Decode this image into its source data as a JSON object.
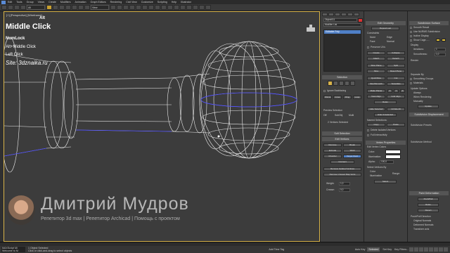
{
  "menu": [
    "Edit",
    "Tools",
    "Group",
    "Views",
    "Create",
    "Modifiers",
    "Animation",
    "Graph Editors",
    "Rendering",
    "Civil View",
    "Customize",
    "Scripting",
    "Help",
    "Illustrator"
  ],
  "toolbar": {
    "selection_filter": "All",
    "view_dropdown": "View"
  },
  "viewport": {
    "label": "[+] [Perspective] [Wireframe]"
  },
  "keys": {
    "alt": "Alt",
    "middle_click": "Middle Click",
    "numlock": "NumLock",
    "alt_middle_click": "Alt+Middle Click",
    "left_click": "Left Click",
    "site": "Site: 3dznaika.ru"
  },
  "author": {
    "name": "Дмитрий Мудров",
    "subtitle": "Репетитор 3d max | Репетитор Archicad | Помощь с проектом"
  },
  "status": {
    "script_box": "MAXScript Mi",
    "welcome": "Welcome to M",
    "object_selected": "1 Object Selected",
    "hint": "Click or click-and-drag to select objects",
    "selected_badge": "Selected",
    "add_time_tag": "Add Time Tag",
    "auto_key": "Auto Key",
    "set_key": "Set Key",
    "key_filters": "Key Filters..."
  },
  "panel_mid": {
    "object_name": "Object011",
    "modifier_list": "Modifier List",
    "stack_item": "Editable Poly",
    "selection_rollout": "Selection",
    "ignore_backfacing": "Ignore Backfacing",
    "grow": "Grow",
    "shrink": "Shrink",
    "ring": "Ring",
    "loop": "Loop",
    "preview_selection": "Preview Selection",
    "preview_opts": [
      "Off",
      "SubObj",
      "Multi"
    ],
    "vertices_selected": "2 Vertices Selected",
    "soft_selection": "Soft Selection",
    "edit_vertices": "Edit Vertices",
    "remove": "Remove",
    "break": "Break",
    "extrude": "Extrude",
    "weld": "Weld",
    "chamfer": "Chamfer",
    "target_weld": "Target Weld",
    "connect": "Connect",
    "remove_isolated": "Remove Isolated Vertices",
    "remove_unused": "Remove Unused Map Verts",
    "weight_label": "Weight:",
    "weight_value": "1,0",
    "crease_label": "Crease:",
    "crease_value": "0,0"
  },
  "panel_right": {
    "edit_geometry": "Edit Geometry",
    "repeat_last": "Repeat Last",
    "constraints": "Constraints",
    "constraint_opts": [
      "None",
      "Edge",
      "Face",
      "Normal"
    ],
    "preserve_uvs": "Preserve UVs",
    "create": "Create",
    "collapse": "Collapse",
    "attach": "Attach",
    "detach": "Detach",
    "slice_plane": "Slice Plane",
    "split": "Split",
    "slice": "Slice",
    "reset_plane": "Reset Plane",
    "quickslice": "QuickSlice",
    "cut": "Cut",
    "meshsmooth": "MeshSmooth",
    "tessellate": "Tessellate",
    "make_planar": "Make Planar",
    "xyz": [
      "X",
      "Y",
      "Z"
    ],
    "view_align": "View Align",
    "grid_align": "Grid Align",
    "relax": "Relax",
    "hide_selected": "Hide Selected",
    "unhide_all": "Unhide All",
    "hide_unselected": "Hide Unselected",
    "named_selections": "Named Selections:",
    "copy": "Copy",
    "paste": "Paste",
    "delete_isolated": "Delete Isolated Vertices",
    "full_interactivity": "Full Interactivity",
    "vertex_properties": "Vertex Properties",
    "edit_vertex_colors": "Edit Vertex Colors",
    "color_label": "Color:",
    "illumination_label": "Illumination:",
    "alpha_label": "Alpha:",
    "alpha_value": "100,0",
    "select_by_vertex": "Select Vertices By",
    "color_opt": "Color",
    "illum_opt": "Illumination",
    "range_label": "Range:",
    "select": "Select"
  },
  "panel_far": {
    "subdivision_surface": "Subdivision Surface",
    "smooth_result": "Smooth Result",
    "use_nurms": "Use NURMS Subdivision",
    "isoline_display": "Isoline Display",
    "show_cage": "Show Cage......",
    "display": "Display",
    "iterations_label": "Iterations:",
    "iterations_value": "1",
    "smoothness_label": "Smoothness:",
    "smoothness_value": "1,0",
    "render": "Render",
    "separate_by": "Separate By",
    "smoothing_groups": "Smoothing Groups",
    "materials": "Materials",
    "update_options": "Update Options",
    "always": "Always",
    "when_rendering": "When Rendering",
    "manually": "Manually",
    "update": "Update",
    "subdivision_displacement": "Subdivision Displacement",
    "subdivision_presets": "Subdivision Presets",
    "subdivision_method": "Subdivision Method",
    "paint_deformation": "Paint Deformation",
    "push_pull": "Push/Pull",
    "relax_btn": "Relax",
    "revert": "Revert",
    "push_pull_direction": "Push/Pull Direction",
    "original_normals": "Original Normals",
    "deformed_normals": "Deformed Normals",
    "transform_axis": "Transform axis"
  },
  "colors": {
    "viewport_bg": "#3c3c3c",
    "wire": "#ececec",
    "selected_edge": "#3c3cff",
    "accent_blue": "#4f7fc6",
    "panel_bg": "#3f3f3f",
    "highlight_yellow": "#d8b34a"
  }
}
